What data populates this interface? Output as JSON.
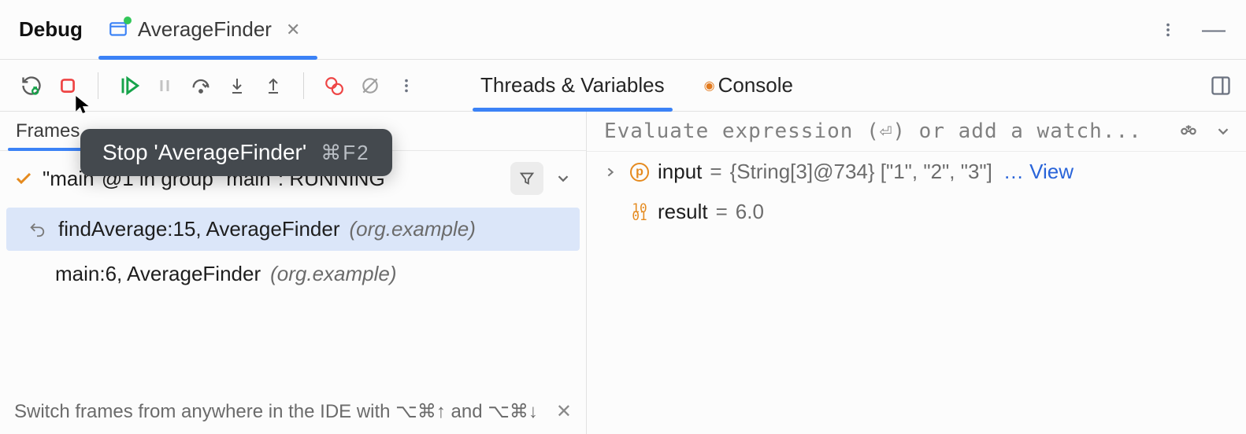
{
  "title": "Debug",
  "tab": {
    "label": "AverageFinder"
  },
  "toolbar_icons": [
    "restart-debug",
    "stop",
    "resume",
    "pause",
    "step-over",
    "step-into",
    "step-out",
    "breakpoints",
    "mute-breakpoints",
    "more"
  ],
  "tooltip": {
    "text": "Stop 'AverageFinder'",
    "shortcut": "⌘F2"
  },
  "content_tabs": {
    "left": "Threads & Variables",
    "right": "Console"
  },
  "frames_tab": "Frames",
  "thread": {
    "text": "\"main\"@1 in group \"main\": RUNNING"
  },
  "frames": [
    {
      "where": "findAverage:15, AverageFinder",
      "pkg": "(org.example)"
    },
    {
      "where": "main:6, AverageFinder",
      "pkg": "(org.example)"
    }
  ],
  "hint": {
    "text": "Switch frames from anywhere in the IDE with ⌥⌘↑ and ⌥⌘↓"
  },
  "eval": {
    "placeholder": "Evaluate expression (⏎) or add a watch..."
  },
  "vars": {
    "input": {
      "name": "input",
      "eq": " = ",
      "val": "{String[3]@734} [\"1\", \"2\", \"3\"]",
      "more": "… View"
    },
    "result": {
      "name": "result",
      "eq": " = ",
      "val": "6.0"
    }
  }
}
